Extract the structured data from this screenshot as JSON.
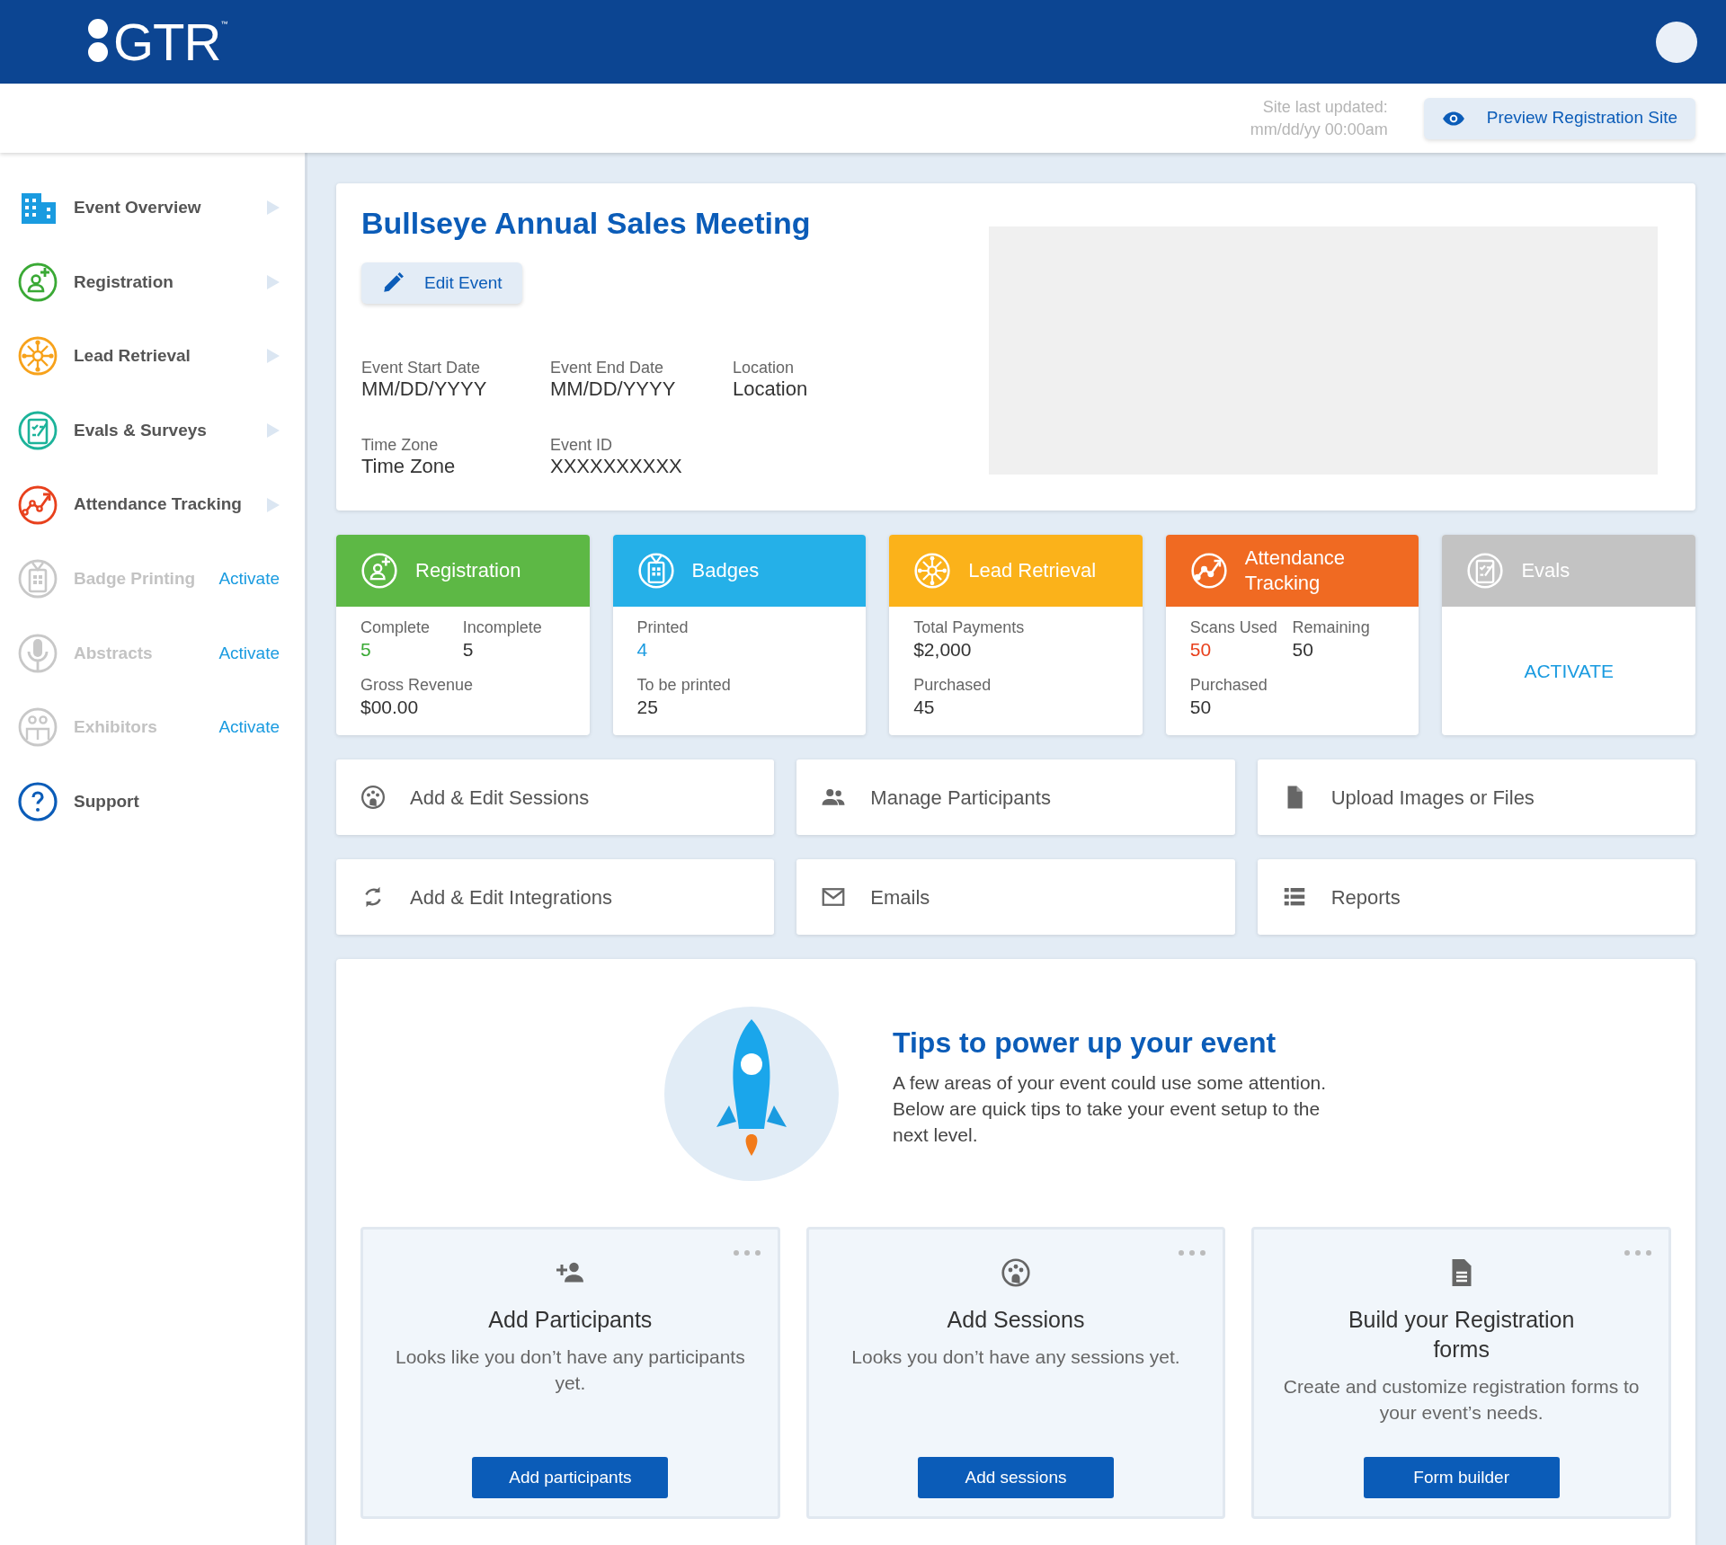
{
  "header": {
    "logo": "GTR",
    "trademark": "™"
  },
  "subheader": {
    "updated_label": "Site last updated:",
    "updated_value": "mm/dd/yy 00:00am",
    "preview_button": "Preview Registration Site"
  },
  "sidebar": {
    "items": [
      {
        "label": "Event Overview",
        "kind": "nav"
      },
      {
        "label": "Registration",
        "kind": "nav"
      },
      {
        "label": "Lead Retrieval",
        "kind": "nav"
      },
      {
        "label": "Evals & Surveys",
        "kind": "nav"
      },
      {
        "label": "Attendance Tracking",
        "kind": "nav"
      },
      {
        "label": "Badge Printing",
        "kind": "activate",
        "action": "Activate"
      },
      {
        "label": "Abstracts",
        "kind": "activate",
        "action": "Activate"
      },
      {
        "label": "Exhibitors",
        "kind": "activate",
        "action": "Activate"
      },
      {
        "label": "Support",
        "kind": "plain"
      }
    ]
  },
  "event": {
    "title": "Bullseye Annual Sales Meeting",
    "edit_button": "Edit Event",
    "fields": [
      {
        "label": "Event Start Date",
        "value": "MM/DD/YYYY"
      },
      {
        "label": "Event End Date",
        "value": "MM/DD/YYYY"
      },
      {
        "label": "Location",
        "value": "Location"
      },
      {
        "label": "Time Zone",
        "value": "Time Zone"
      },
      {
        "label": "Event ID",
        "value": "XXXXXXXXXX"
      }
    ]
  },
  "stat_cards": [
    {
      "title": "Registration",
      "color": "#5db845",
      "kind": "stats",
      "rows": [
        [
          {
            "label": "Complete",
            "value": "5",
            "color": "#3aa935"
          },
          {
            "label": "Incomplete",
            "value": "5"
          }
        ],
        [
          {
            "label": "Gross Revenue",
            "value": "$00.00"
          }
        ]
      ]
    },
    {
      "title": "Badges",
      "color": "#25b0e8",
      "kind": "stats",
      "rows": [
        [
          {
            "label": "Printed",
            "value": "4",
            "color": "#1a9be0"
          }
        ],
        [
          {
            "label": "To be printed",
            "value": "25"
          }
        ]
      ]
    },
    {
      "title": "Lead Retrieval",
      "color": "#fbb21a",
      "kind": "stats",
      "rows": [
        [
          {
            "label": "Total Payments",
            "value": "$2,000"
          }
        ],
        [
          {
            "label": "Purchased",
            "value": "45"
          }
        ]
      ]
    },
    {
      "title": "Attendance Tracking",
      "color": "#f06a22",
      "kind": "stats",
      "rows": [
        [
          {
            "label": "Scans Used",
            "value": "50",
            "color": "#e8401c"
          },
          {
            "label": "Remaining",
            "value": "50"
          }
        ],
        [
          {
            "label": "Purchased",
            "value": "50"
          }
        ]
      ]
    },
    {
      "title": "Evals",
      "color": "#c3c3c3",
      "kind": "activate",
      "action": "ACTIVATE"
    }
  ],
  "actions": [
    {
      "label": "Add & Edit Sessions"
    },
    {
      "label": "Manage Participants"
    },
    {
      "label": "Upload Images or Files"
    },
    {
      "label": "Add & Edit Integrations"
    },
    {
      "label": "Emails"
    },
    {
      "label": "Reports"
    }
  ],
  "tips": {
    "title": "Tips to power up your event",
    "text": "A few areas of your event could use some attention. Below are quick tips to take your event setup to the next level.",
    "cards": [
      {
        "title": "Add Participants",
        "text": "Looks like you don’t have any participants yet.",
        "button": "Add participants"
      },
      {
        "title": "Add Sessions",
        "text": "Looks you don’t have any sessions yet.",
        "button": "Add sessions"
      },
      {
        "title": "Build your Registration forms",
        "text": "Create and customize registration forms to your event’s needs.",
        "button": "Form builder"
      }
    ]
  }
}
